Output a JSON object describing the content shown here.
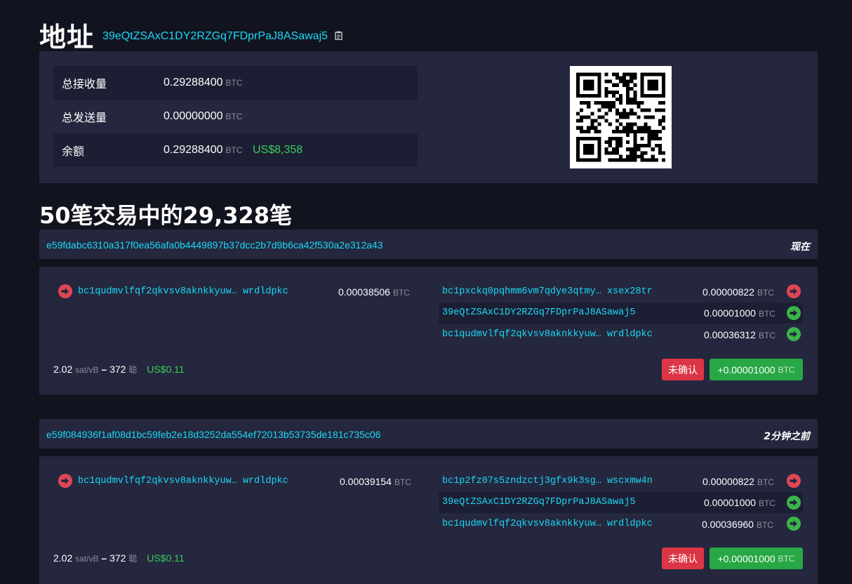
{
  "header": {
    "title": "地址",
    "address": "39eQtZSAxC1DY2RZGq7FDprPaJ8ASawaj5"
  },
  "summary": {
    "rows": [
      {
        "label": "总接收量",
        "value": "0.29288400",
        "unit": "BTC"
      },
      {
        "label": "总发送量",
        "value": "0.00000000",
        "unit": "BTC"
      },
      {
        "label": "余额",
        "value": "0.29288400",
        "unit": "BTC",
        "fiat": "US$8,358"
      }
    ]
  },
  "tx_count_heading": "50笔交易中的29,328笔",
  "transactions": [
    {
      "txid": "e59fdabc6310a317f0ea56afa0b4449897b37dcc2b7d9b6ca42f530a2e312a43",
      "time": "现在",
      "input": {
        "address": "bc1qudmvlfqf2qkvsv8aknkkyuw… wrdldpkc",
        "amount": "0.00038506",
        "unit": "BTC"
      },
      "outputs": [
        {
          "address": "bc1pxckq0pqhmm6vm7qdye3qtmy… xsex28tr",
          "amount": "0.00000822",
          "unit": "BTC",
          "arrow": "red"
        },
        {
          "address": "39eQtZSAxC1DY2RZGq7FDprPaJ8ASawaj5",
          "amount": "0.00001000",
          "unit": "BTC",
          "arrow": "green"
        },
        {
          "address": "bc1qudmvlfqf2qkvsv8aknkkyuw… wrdldpkc",
          "amount": "0.00036312",
          "unit": "BTC",
          "arrow": "green"
        }
      ],
      "fee_rate": "2.02",
      "fee_rate_unit": "sat/vB",
      "dash": "–",
      "vsize": "372",
      "vsize_unit": "聪",
      "fee_fiat": "US$0.11",
      "status_label": "未确认",
      "delta": "+0.00001000",
      "delta_unit": "BTC"
    },
    {
      "txid": "e59f084936f1af08d1bc59feb2e18d3252da554ef72013b53735de181c735c06",
      "time": "2分钟之前",
      "input": {
        "address": "bc1qudmvlfqf2qkvsv8aknkkyuw… wrdldpkc",
        "amount": "0.00039154",
        "unit": "BTC"
      },
      "outputs": [
        {
          "address": "bc1p2fz07s5zndzctj3gfx9k3sg… wscxmw4n",
          "amount": "0.00000822",
          "unit": "BTC",
          "arrow": "red"
        },
        {
          "address": "39eQtZSAxC1DY2RZGq7FDprPaJ8ASawaj5",
          "amount": "0.00001000",
          "unit": "BTC",
          "arrow": "green"
        },
        {
          "address": "bc1qudmvlfqf2qkvsv8aknkkyuw… wrdldpkc",
          "amount": "0.00036960",
          "unit": "BTC",
          "arrow": "green"
        }
      ],
      "fee_rate": "2.02",
      "fee_rate_unit": "sat/vB",
      "dash": "–",
      "vsize": "372",
      "vsize_unit": "聪",
      "fee_fiat": "US$0.11",
      "status_label": "未确认",
      "delta": "+0.00001000",
      "delta_unit": "BTC"
    }
  ],
  "colors": {
    "background": "#11131f",
    "panel": "#24273e",
    "link": "#1bd8f4",
    "positive": "#3bcd5e",
    "unconfirmed": "#dc3545",
    "amount_button": "#28a745"
  },
  "icons": {
    "copy": "clipboard-icon",
    "input_arrow": "arrow-circle-right-icon",
    "qr": "qr-code-icon"
  }
}
